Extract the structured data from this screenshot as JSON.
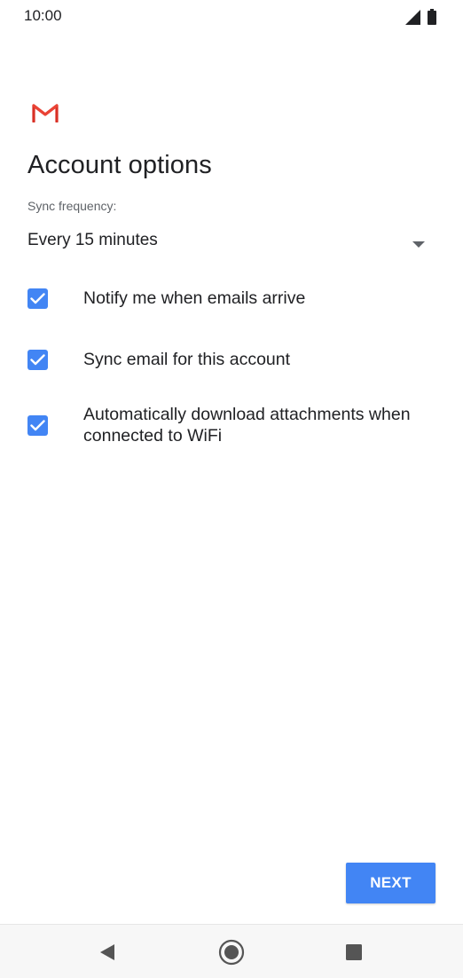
{
  "status_bar": {
    "time": "10:00",
    "icons": [
      "signal-icon",
      "battery-icon"
    ]
  },
  "app": {
    "logo_icon": "gmail-logo-icon"
  },
  "page": {
    "title": "Account options"
  },
  "sync": {
    "label": "Sync frequency:",
    "value": "Every 15 minutes"
  },
  "options": [
    {
      "label": "Notify me when emails arrive",
      "checked": true
    },
    {
      "label": "Sync email for this account",
      "checked": true
    },
    {
      "label": "Automatically download attachments when connected to WiFi",
      "checked": true
    }
  ],
  "actions": {
    "next_label": "NEXT"
  },
  "navigation": {
    "buttons": [
      "back-icon",
      "home-icon",
      "recents-icon"
    ]
  },
  "colors": {
    "accent": "#4285f4",
    "gmail_red": "#d93025",
    "text_primary": "#202124",
    "text_secondary": "#5f6368"
  }
}
